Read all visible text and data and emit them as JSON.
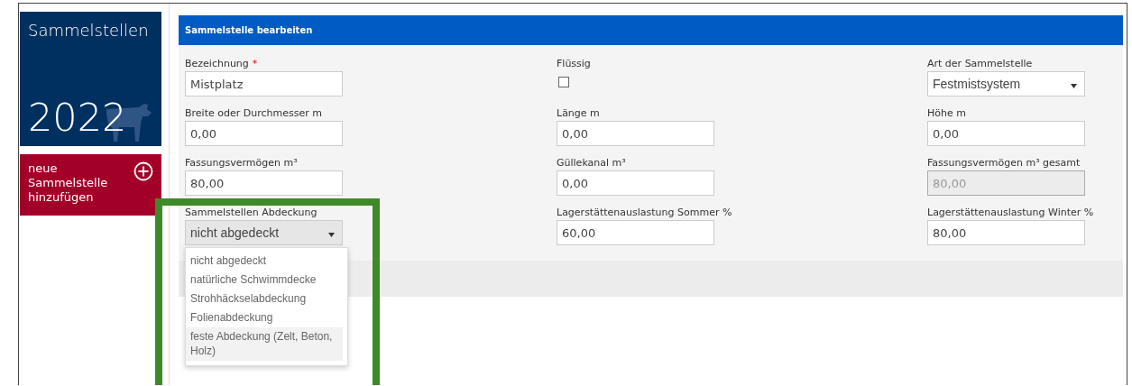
{
  "sidebar": {
    "title": "Sammelstellen",
    "year": "2022",
    "add_button": "neue Sammelstelle hinzufügen"
  },
  "panel": {
    "title": "Sammelstelle bearbeiten",
    "fields": [
      {
        "kind": "text",
        "label": "Bezeichnung",
        "required_mark": "*",
        "value": "Mistplatz"
      },
      {
        "kind": "checkbox",
        "label": "Flüssig",
        "checked": false
      },
      {
        "kind": "select",
        "label": "Art der Sammelstelle",
        "value": "Festmistsystem",
        "open": false
      },
      {
        "kind": "text",
        "label": "Breite oder Durchmesser m",
        "value": "0,00"
      },
      {
        "kind": "text",
        "label": "Länge m",
        "value": "0,00"
      },
      {
        "kind": "text",
        "label": "Höhe m",
        "value": "0,00"
      },
      {
        "kind": "text",
        "label": "Fassungsvermögen m³",
        "value": "80,00"
      },
      {
        "kind": "text",
        "label": "Güllekanal m³",
        "value": "0,00"
      },
      {
        "kind": "readonly",
        "label": "Fassungsvermögen m³ gesamt",
        "value": "80,00"
      },
      {
        "kind": "select",
        "label": "Sammelstellen Abdeckung",
        "value": "nicht abgedeckt",
        "open": true,
        "options": [
          {
            "label": "nicht abgedeckt",
            "highlighted": false
          },
          {
            "label": "natürliche Schwimmdecke",
            "highlighted": false
          },
          {
            "label": "Strohhäckselabdeckung",
            "highlighted": false
          },
          {
            "label": "Folienabdeckung",
            "highlighted": false
          },
          {
            "label": "feste Abdeckung (Zelt, Beton, Holz)",
            "highlighted": true
          }
        ]
      },
      {
        "kind": "text",
        "label": "Lagerstättenauslastung Sommer %",
        "value": "60,00"
      },
      {
        "kind": "text",
        "label": "Lagerstättenauslastung Winter %",
        "value": "80,00"
      }
    ]
  },
  "highlight_frame": {
    "color": "#3e8a28"
  }
}
